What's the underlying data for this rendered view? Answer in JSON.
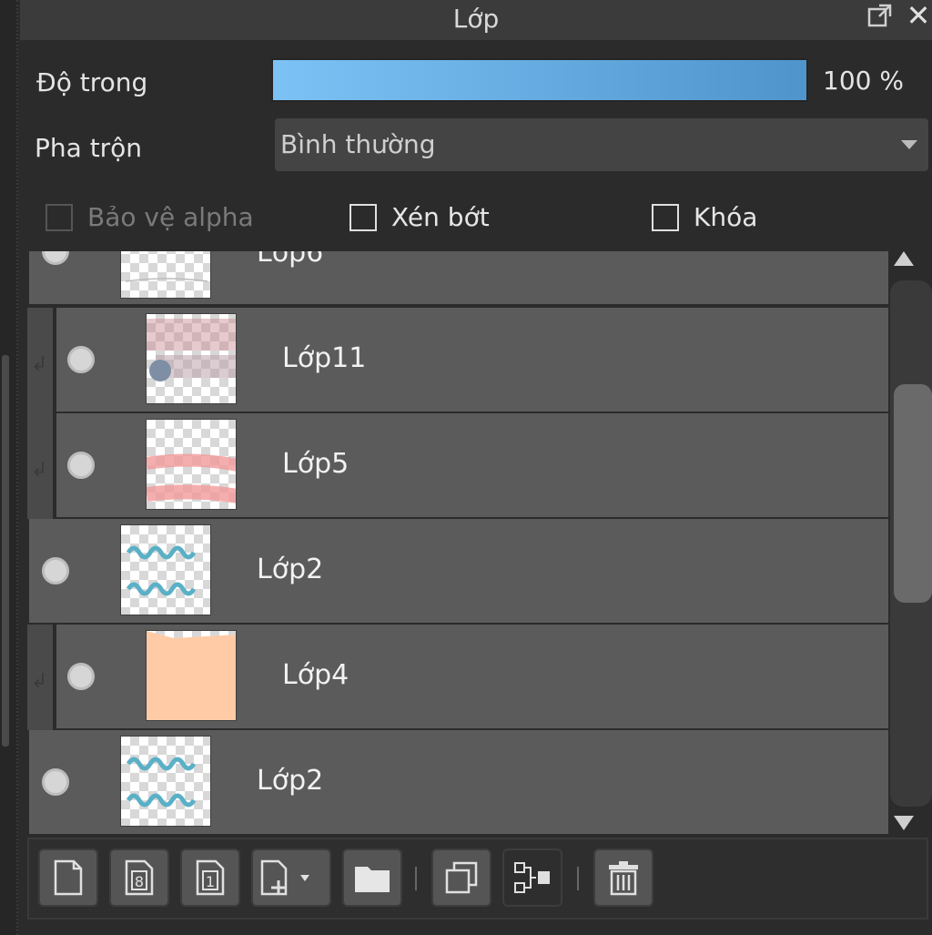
{
  "panel": {
    "title": "Lớp"
  },
  "opacity": {
    "label": "Độ trong",
    "value_text": "100 %",
    "percent": 100
  },
  "blend": {
    "label": "Pha trộn",
    "selected": "Bình thường"
  },
  "checkboxes": {
    "protect_alpha": "Bảo vệ alpha",
    "clipping": "Xén bớt",
    "lock": "Khóa"
  },
  "layers": [
    {
      "name": "Lớp6",
      "clipped": false
    },
    {
      "name": "Lớp11",
      "clipped": true
    },
    {
      "name": "Lớp5",
      "clipped": true
    },
    {
      "name": "Lớp2",
      "clipped": false
    },
    {
      "name": "Lớp4",
      "clipped": true
    },
    {
      "name": "Lớp2",
      "clipped": false
    }
  ],
  "colors": {
    "opacity_start": "#7cc2f5",
    "opacity_end": "#4f95cc",
    "layer_bg": "#5b5b5b",
    "lop4_fill": "#ffcba6"
  },
  "toolbar_icons": [
    "new-layer-icon",
    "new-8bit-layer-icon",
    "new-1bit-layer-icon",
    "add-layer-dropdown-icon",
    "new-folder-icon",
    "duplicate-layer-icon",
    "merge-layer-icon",
    "delete-layer-icon"
  ]
}
